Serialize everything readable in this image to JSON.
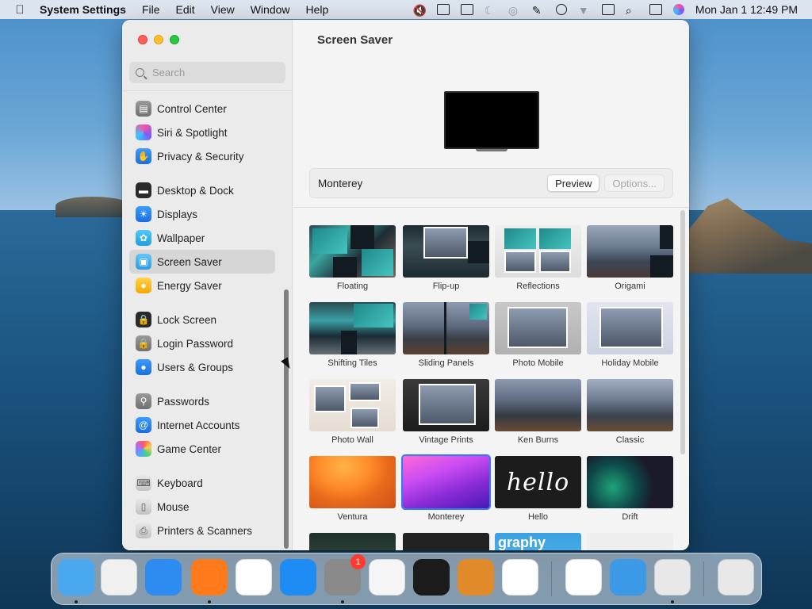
{
  "menubar": {
    "app_name": "System Settings",
    "menus": [
      "File",
      "Edit",
      "View",
      "Window",
      "Help"
    ],
    "clock": "Mon Jan 1  12:49 PM"
  },
  "window": {
    "title": "Screen Saver",
    "search_placeholder": "Search",
    "sidebar_groups": [
      [
        {
          "label": "Control Center",
          "icon": "control-center-icon"
        },
        {
          "label": "Siri & Spotlight",
          "icon": "siri-icon"
        },
        {
          "label": "Privacy & Security",
          "icon": "hand-icon"
        }
      ],
      [
        {
          "label": "Desktop & Dock",
          "icon": "dock-icon"
        },
        {
          "label": "Displays",
          "icon": "sun-icon"
        },
        {
          "label": "Wallpaper",
          "icon": "flower-icon"
        },
        {
          "label": "Screen Saver",
          "icon": "screensaver-icon",
          "selected": true
        },
        {
          "label": "Energy Saver",
          "icon": "bulb-icon"
        }
      ],
      [
        {
          "label": "Lock Screen",
          "icon": "lock-icon"
        },
        {
          "label": "Login Password",
          "icon": "lock-outline-icon"
        },
        {
          "label": "Users & Groups",
          "icon": "users-icon"
        }
      ],
      [
        {
          "label": "Passwords",
          "icon": "key-icon"
        },
        {
          "label": "Internet Accounts",
          "icon": "at-icon"
        },
        {
          "label": "Game Center",
          "icon": "game-center-icon"
        }
      ],
      [
        {
          "label": "Keyboard",
          "icon": "keyboard-icon"
        },
        {
          "label": "Mouse",
          "icon": "mouse-icon"
        },
        {
          "label": "Printers & Scanners",
          "icon": "printer-icon"
        }
      ]
    ]
  },
  "screen_saver": {
    "current": "Monterey",
    "preview_label": "Preview",
    "options_label": "Options...",
    "tiles": [
      {
        "label": "Floating",
        "thumb": "th-floating"
      },
      {
        "label": "Flip-up",
        "thumb": "th-flipup"
      },
      {
        "label": "Reflections",
        "thumb": "th-reflections"
      },
      {
        "label": "Origami",
        "thumb": "th-origami"
      },
      {
        "label": "Shifting Tiles",
        "thumb": "th-shifting"
      },
      {
        "label": "Sliding Panels",
        "thumb": "th-sliding"
      },
      {
        "label": "Photo Mobile",
        "thumb": "th-photomobile"
      },
      {
        "label": "Holiday Mobile",
        "thumb": "th-holiday"
      },
      {
        "label": "Photo Wall",
        "thumb": "th-photowall"
      },
      {
        "label": "Vintage Prints",
        "thumb": "th-vintage"
      },
      {
        "label": "Ken Burns",
        "thumb": "th-kenburns"
      },
      {
        "label": "Classic",
        "thumb": "th-classic"
      },
      {
        "label": "Ventura",
        "thumb": "th-ventura"
      },
      {
        "label": "Monterey",
        "thumb": "th-monterey",
        "selected": true
      },
      {
        "label": "Hello",
        "thumb": "th-hello",
        "hello_text": "hello"
      },
      {
        "label": "Drift",
        "thumb": "th-drift"
      }
    ],
    "partial_row_text": "graphy"
  },
  "dock": {
    "apps": [
      {
        "name": "finder-icon",
        "color": "#4aa8f0",
        "running": true
      },
      {
        "name": "launchpad-icon",
        "color": "#f0f0f0",
        "running": false
      },
      {
        "name": "safari-icon",
        "color": "#2e8cf0",
        "running": false
      },
      {
        "name": "firefox-icon",
        "color": "#ff7a1a",
        "running": true
      },
      {
        "name": "chrome-icon",
        "color": "#ffffff",
        "running": false
      },
      {
        "name": "app-store-icon",
        "color": "#1f8cf5",
        "running": false
      },
      {
        "name": "system-settings-icon",
        "color": "#8a8a8a",
        "running": true,
        "badge": "1"
      },
      {
        "name": "textedit-icon",
        "color": "#f5f5f5",
        "running": false
      },
      {
        "name": "terminal-icon",
        "color": "#1c1c1c",
        "running": false
      },
      {
        "name": "garageband-icon",
        "color": "#e08a2a",
        "running": false
      },
      {
        "name": "vscode-icon",
        "color": "#ffffff",
        "running": false
      },
      {
        "name": "visual-studio-icon",
        "color": "#ffffff",
        "running": false
      },
      {
        "name": "weather-icon",
        "color": "#3a9ae8",
        "running": false
      },
      {
        "name": "script-editor-icon",
        "color": "#e8e8e8",
        "running": true
      },
      {
        "name": "trash-icon",
        "color": "#e8e8e8",
        "running": false
      }
    ]
  }
}
